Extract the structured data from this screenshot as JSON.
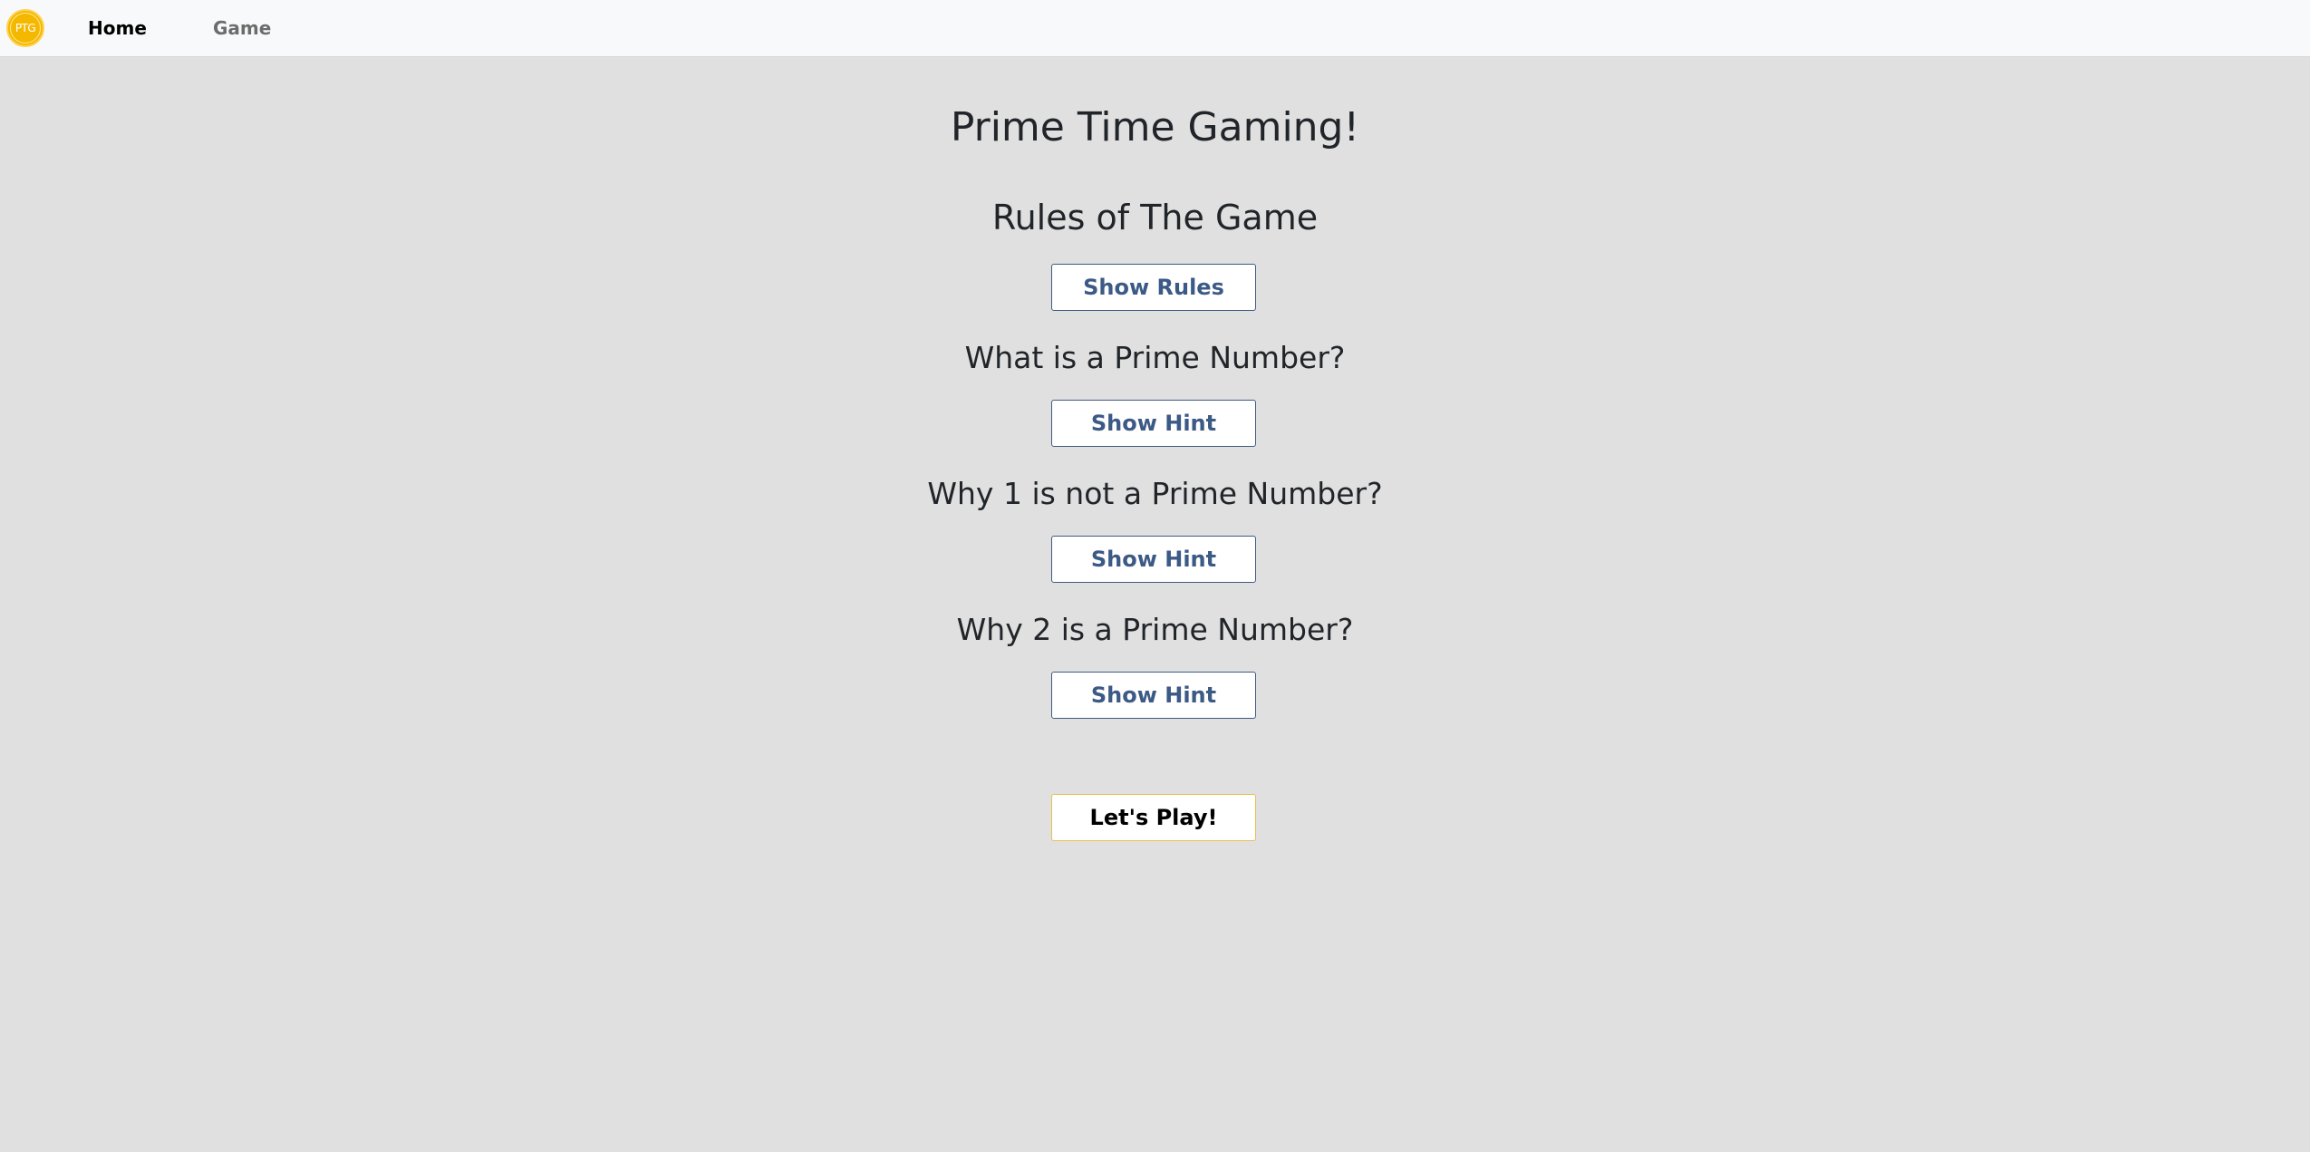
{
  "nav": {
    "logo_text": "PTG",
    "items": [
      {
        "label": "Home",
        "active": true
      },
      {
        "label": "Game",
        "active": false
      }
    ]
  },
  "main": {
    "title": "Prime Time Gaming!",
    "rules_heading": "Rules of The Game",
    "show_rules_label": "Show Rules",
    "sections": [
      {
        "question": "What is a Prime Number?",
        "button": "Show Hint"
      },
      {
        "question": "Why 1 is not a Prime Number?",
        "button": "Show Hint"
      },
      {
        "question": "Why 2 is a Prime Number?",
        "button": "Show Hint"
      }
    ],
    "play_label": "Let's Play!"
  },
  "colors": {
    "background": "#e0e0e0",
    "navbar": "#f8f9fa",
    "logo": "#f5b800",
    "button_text": "#3c5a86",
    "button_border": "#3e5a80",
    "play_border": "#e8c04a"
  }
}
